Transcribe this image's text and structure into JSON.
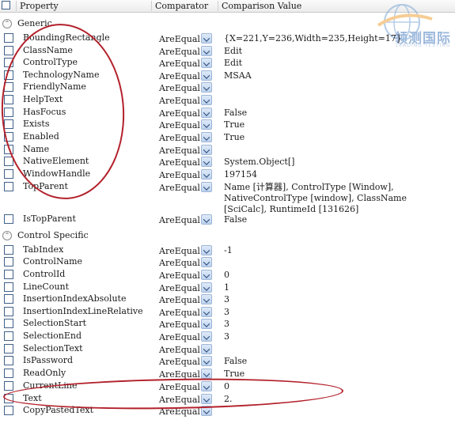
{
  "header": {
    "property": "Property",
    "comparator": "Comparator",
    "comparison_value": "Comparison Value"
  },
  "groups": {
    "generic": "Generic",
    "control_specific": "Control Specific"
  },
  "rows": [
    {
      "property": "BoundingRectangle",
      "comparator": "AreEqual",
      "value": "{X=221,Y=236,Width=235,Height=17}"
    },
    {
      "property": "ClassName",
      "comparator": "AreEqual",
      "value": "Edit"
    },
    {
      "property": "ControlType",
      "comparator": "AreEqual",
      "value": "Edit"
    },
    {
      "property": "TechnologyName",
      "comparator": "AreEqual",
      "value": "MSAA"
    },
    {
      "property": "FriendlyName",
      "comparator": "AreEqual",
      "value": ""
    },
    {
      "property": "HelpText",
      "comparator": "AreEqual",
      "value": ""
    },
    {
      "property": "HasFocus",
      "comparator": "AreEqual",
      "value": "False"
    },
    {
      "property": "Exists",
      "comparator": "AreEqual",
      "value": "True"
    },
    {
      "property": "Enabled",
      "comparator": "AreEqual",
      "value": "True"
    },
    {
      "property": "Name",
      "comparator": "AreEqual",
      "value": ""
    },
    {
      "property": "NativeElement",
      "comparator": "AreEqual",
      "value": "System.Object[]"
    },
    {
      "property": "WindowHandle",
      "comparator": "AreEqual",
      "value": "197154"
    },
    {
      "property": "TopParent",
      "comparator": "AreEqual",
      "value": "Name [计算器], ControlType [Window],",
      "value2": "NativeControlType [window], ClassName",
      "value3": "[SciCalc], RuntimeId [131626]"
    },
    {
      "property": "IsTopParent",
      "comparator": "AreEqual",
      "value": "False"
    },
    {
      "property": "TabIndex",
      "comparator": "AreEqual",
      "value": "-1"
    },
    {
      "property": "ControlName",
      "comparator": "AreEqual",
      "value": ""
    },
    {
      "property": "ControlId",
      "comparator": "AreEqual",
      "value": "0"
    },
    {
      "property": "LineCount",
      "comparator": "AreEqual",
      "value": "1"
    },
    {
      "property": "InsertionIndexAbsolute",
      "comparator": "AreEqual",
      "value": "3"
    },
    {
      "property": "InsertionIndexLineRelative",
      "comparator": "AreEqual",
      "value": "3"
    },
    {
      "property": "SelectionStart",
      "comparator": "AreEqual",
      "value": "3"
    },
    {
      "property": "SelectionEnd",
      "comparator": "AreEqual",
      "value": "3"
    },
    {
      "property": "SelectionText",
      "comparator": "AreEqual",
      "value": ""
    },
    {
      "property": "IsPassword",
      "comparator": "AreEqual",
      "value": "False"
    },
    {
      "property": "ReadOnly",
      "comparator": "AreEqual",
      "value": "True"
    },
    {
      "property": "CurrentLine",
      "comparator": "AreEqual",
      "value": "0"
    },
    {
      "property": "Text",
      "comparator": "AreEqual",
      "value": "2."
    },
    {
      "property": "CopyPastedText",
      "comparator": "AreEqual",
      "value": ""
    }
  ],
  "logo": {
    "text": "领测国际",
    "subtext": "LEADING TESTING"
  },
  "colors": {
    "annotation": "#b3212b",
    "checkbox_border": "#41618a",
    "dropdown": "#bdd2ee"
  }
}
